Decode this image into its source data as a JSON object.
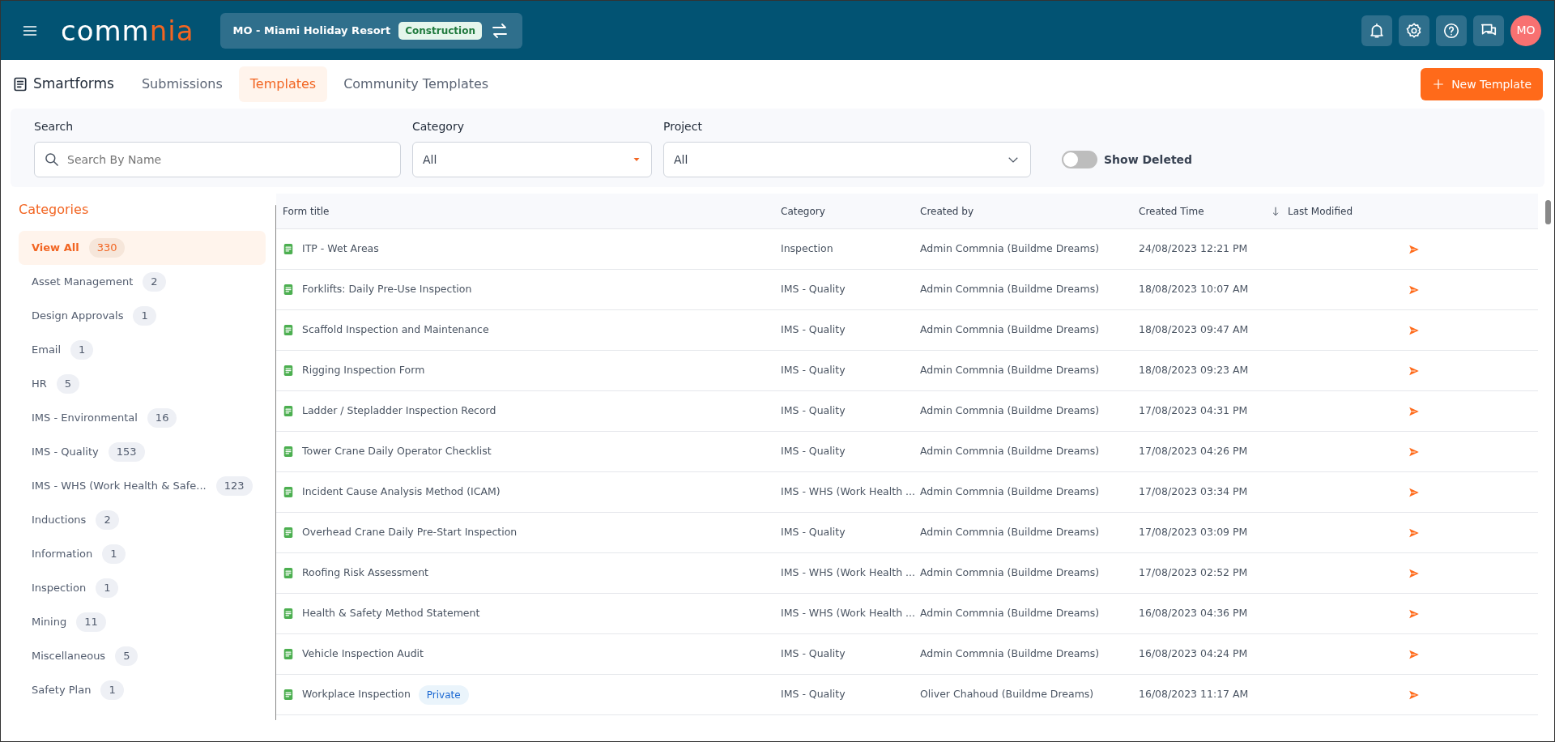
{
  "header": {
    "logo_parts": [
      {
        "text": "comm",
        "accent": false
      },
      {
        "text": "nia",
        "accent": true
      }
    ],
    "project": {
      "name": "MO - Miami Holiday Resort",
      "stage": "Construction"
    },
    "avatar": "MO"
  },
  "module": {
    "title": "Smartforms",
    "tabs": [
      {
        "label": "Submissions",
        "selected": false
      },
      {
        "label": "Templates",
        "selected": true
      },
      {
        "label": "Community Templates",
        "selected": false
      }
    ],
    "new_button": "New Template"
  },
  "filters": {
    "search": {
      "label": "Search",
      "placeholder": "Search By Name"
    },
    "category": {
      "label": "Category",
      "value": "All"
    },
    "project": {
      "label": "Project",
      "value": "All"
    },
    "show_deleted": {
      "label": "Show Deleted",
      "on": false
    }
  },
  "categories": {
    "title": "Categories",
    "items": [
      {
        "label": "View All",
        "count": "330",
        "selected": true
      },
      {
        "label": "Asset Management",
        "count": "2",
        "selected": false
      },
      {
        "label": "Design Approvals",
        "count": "1",
        "selected": false
      },
      {
        "label": "Email",
        "count": "1",
        "selected": false
      },
      {
        "label": "HR",
        "count": "5",
        "selected": false
      },
      {
        "label": "IMS - Environmental",
        "count": "16",
        "selected": false
      },
      {
        "label": "IMS - Quality",
        "count": "153",
        "selected": false
      },
      {
        "label": "IMS - WHS (Work Health & Safe...",
        "count": "123",
        "selected": false
      },
      {
        "label": "Inductions",
        "count": "2",
        "selected": false
      },
      {
        "label": "Information",
        "count": "1",
        "selected": false
      },
      {
        "label": "Inspection",
        "count": "1",
        "selected": false
      },
      {
        "label": "Mining",
        "count": "11",
        "selected": false
      },
      {
        "label": "Miscellaneous",
        "count": "5",
        "selected": false
      },
      {
        "label": "Safety Plan",
        "count": "1",
        "selected": false
      }
    ]
  },
  "table": {
    "columns": [
      "Form title",
      "Category",
      "Created by",
      "Created Time",
      "Last Modified"
    ],
    "rows": [
      {
        "title": "ITP - Wet Areas",
        "category": "Inspection",
        "created_by": "Admin Commnia (Buildme Dreams)",
        "created_time": "24/08/2023 12:21 PM"
      },
      {
        "title": "Forklifts: Daily Pre-Use Inspection",
        "category": "IMS - Quality",
        "created_by": "Admin Commnia (Buildme Dreams)",
        "created_time": "18/08/2023 10:07 AM"
      },
      {
        "title": "Scaffold Inspection and Maintenance",
        "category": "IMS - Quality",
        "created_by": "Admin Commnia (Buildme Dreams)",
        "created_time": "18/08/2023 09:47 AM"
      },
      {
        "title": "Rigging Inspection Form",
        "category": "IMS - Quality",
        "created_by": "Admin Commnia (Buildme Dreams)",
        "created_time": "18/08/2023 09:23 AM"
      },
      {
        "title": "Ladder / Stepladder Inspection Record",
        "category": "IMS - Quality",
        "created_by": "Admin Commnia (Buildme Dreams)",
        "created_time": "17/08/2023 04:31 PM"
      },
      {
        "title": "Tower Crane Daily Operator Checklist",
        "category": "IMS - Quality",
        "created_by": "Admin Commnia (Buildme Dreams)",
        "created_time": "17/08/2023 04:26 PM"
      },
      {
        "title": "Incident Cause Analysis Method (ICAM)",
        "category": "IMS - WHS (Work Health ...",
        "created_by": "Admin Commnia (Buildme Dreams)",
        "created_time": "17/08/2023 03:34 PM"
      },
      {
        "title": "Overhead Crane Daily Pre-Start Inspection",
        "category": "IMS - Quality",
        "created_by": "Admin Commnia (Buildme Dreams)",
        "created_time": "17/08/2023 03:09 PM"
      },
      {
        "title": "Roofing Risk Assessment",
        "category": "IMS - WHS (Work Health ...",
        "created_by": "Admin Commnia (Buildme Dreams)",
        "created_time": "17/08/2023 02:52 PM"
      },
      {
        "title": "Health & Safety Method Statement",
        "category": "IMS - WHS (Work Health ...",
        "created_by": "Admin Commnia (Buildme Dreams)",
        "created_time": "16/08/2023 04:36 PM"
      },
      {
        "title": "Vehicle Inspection Audit",
        "category": "IMS - Quality",
        "created_by": "Admin Commnia (Buildme Dreams)",
        "created_time": "16/08/2023 04:24 PM"
      },
      {
        "title": "Workplace Inspection",
        "badge": "Private",
        "category": "IMS - Quality",
        "created_by": "Oliver Chahoud (Buildme Dreams)",
        "created_time": "16/08/2023 11:17 AM"
      }
    ]
  }
}
